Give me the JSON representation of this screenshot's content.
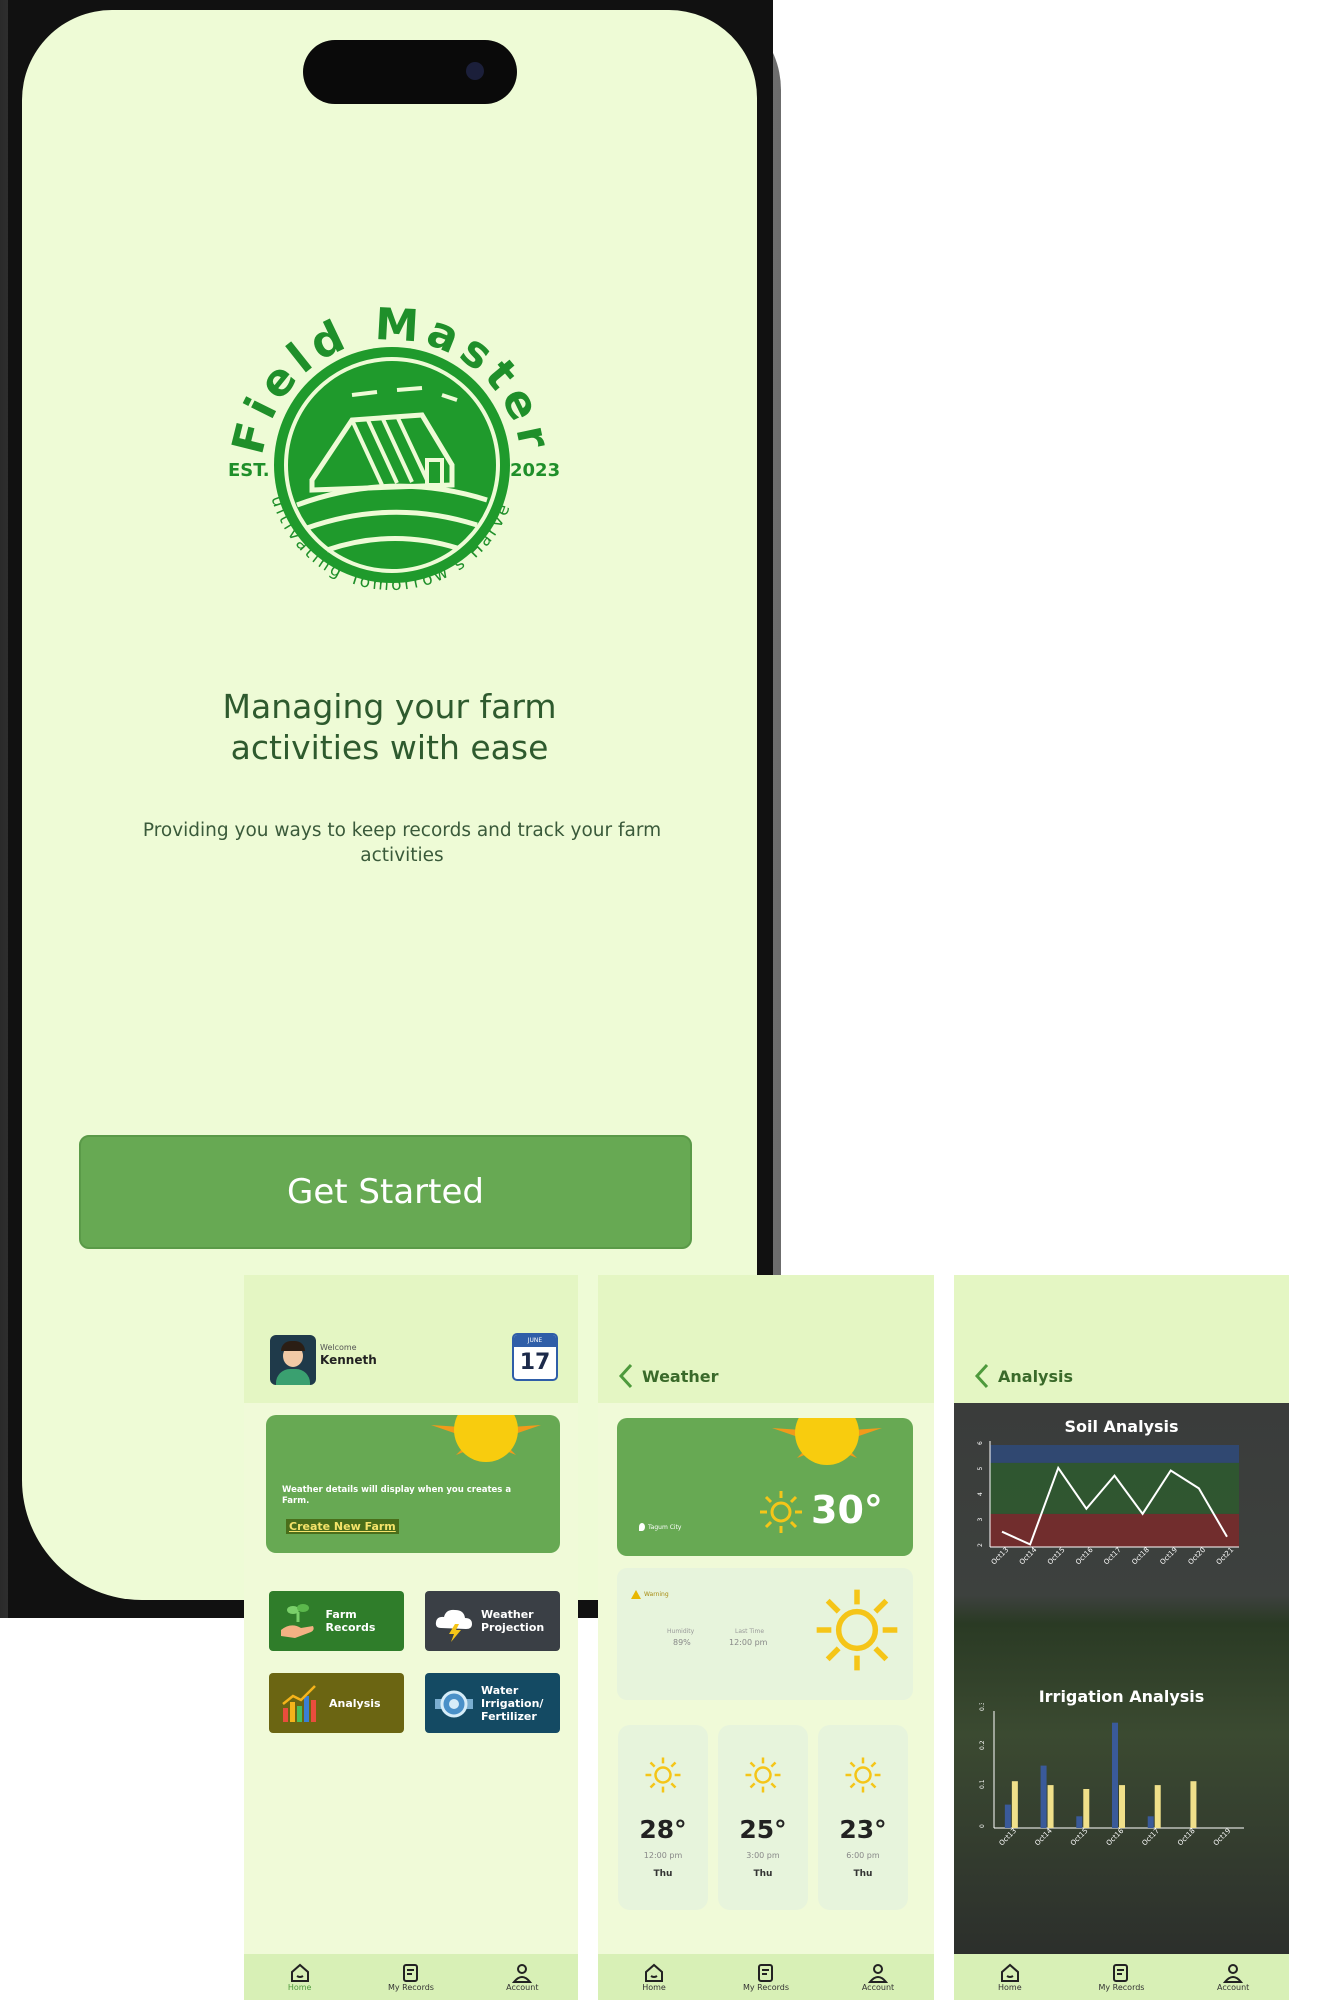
{
  "splash": {
    "logo_title": "Field Master",
    "logo_est": "EST.",
    "logo_year": "2023",
    "logo_motto": "Cultivating Tomorrow's Harvest",
    "tagline": "Managing your farm activities with ease",
    "subtag": "Providing you ways to keep records and track your farm activities",
    "cta": "Get Started"
  },
  "home": {
    "welcome": "Welcome",
    "user": "Kenneth",
    "calendar_month": "JUNE",
    "calendar_day": "17",
    "weather_msg": "Weather details will display when you creates a Farm.",
    "create_farm": "Create New Farm",
    "tiles": [
      {
        "label": "Farm Records",
        "color": "#2f7d2a",
        "icon": "hand-sprout-icon"
      },
      {
        "label": "Weather Projection",
        "color": "#3a3f45",
        "icon": "cloud-bolt-icon"
      },
      {
        "label": "Analysis",
        "color": "#6b6512",
        "icon": "bar-chart-icon"
      },
      {
        "label": "Water Irrigation/ Fertilizer",
        "color": "#144a63",
        "icon": "water-meter-icon"
      }
    ]
  },
  "weather": {
    "title": "Weather",
    "location": "Tagum City",
    "temp": "30°",
    "warning": "Warning",
    "humidity_label": "Humidity",
    "humidity": "89%",
    "time_label": "Last Time",
    "time": "12:00 pm",
    "forecast": [
      {
        "temp": "28°",
        "time": "12:00 pm",
        "day": "Thu"
      },
      {
        "temp": "25°",
        "time": "3:00 pm",
        "day": "Thu"
      },
      {
        "temp": "23°",
        "time": "6:00 pm",
        "day": "Thu"
      }
    ]
  },
  "analysis": {
    "title": "Analysis"
  },
  "nav": {
    "home": "Home",
    "records": "My Records",
    "account": "Account"
  },
  "colors": {
    "accent": "#67a953",
    "background": "#eefbd6",
    "header": "#e4f6c3",
    "text_dark": "#2e5a2e"
  },
  "chart_data": [
    {
      "type": "line",
      "title": "Soil Analysis",
      "categories": [
        "Oct13",
        "Oct14",
        "Oct15",
        "Oct16",
        "Oct17",
        "Oct18",
        "Oct19",
        "Oct20",
        "Oct21"
      ],
      "series": [
        {
          "values": [
            2.6,
            2.1,
            5.1,
            3.5,
            4.8,
            3.3,
            5.0,
            4.3,
            2.4
          ]
        }
      ],
      "ylim": [
        2,
        6
      ],
      "yticks": [
        "2",
        "3",
        "4",
        "5",
        "6"
      ],
      "bands": [
        {
          "from": 2,
          "to": 3.3,
          "color": "#7a2a2a"
        },
        {
          "from": 3.3,
          "to": 5.3,
          "color": "#2e5a2e"
        },
        {
          "from": 5.3,
          "to": 6,
          "color": "#2f4a7a"
        }
      ]
    },
    {
      "type": "bar",
      "title": "Irrigation Analysis",
      "categories": [
        "Oct13",
        "Oct14",
        "Oct15",
        "Oct16",
        "Oct17",
        "Oct18",
        "Oct19"
      ],
      "series": [
        {
          "values": [
            0.06,
            0.16,
            0.03,
            0.27,
            0.03,
            0.0,
            0.0
          ],
          "color": "#3a5a9a"
        },
        {
          "values": [
            0.12,
            0.11,
            0.1,
            0.11,
            0.11,
            0.12,
            0.0
          ],
          "color": "#f0e08a"
        }
      ],
      "ylim": [
        0,
        0.3
      ],
      "yticks": [
        "0",
        "0.1",
        "0.2",
        "0.3"
      ]
    }
  ]
}
